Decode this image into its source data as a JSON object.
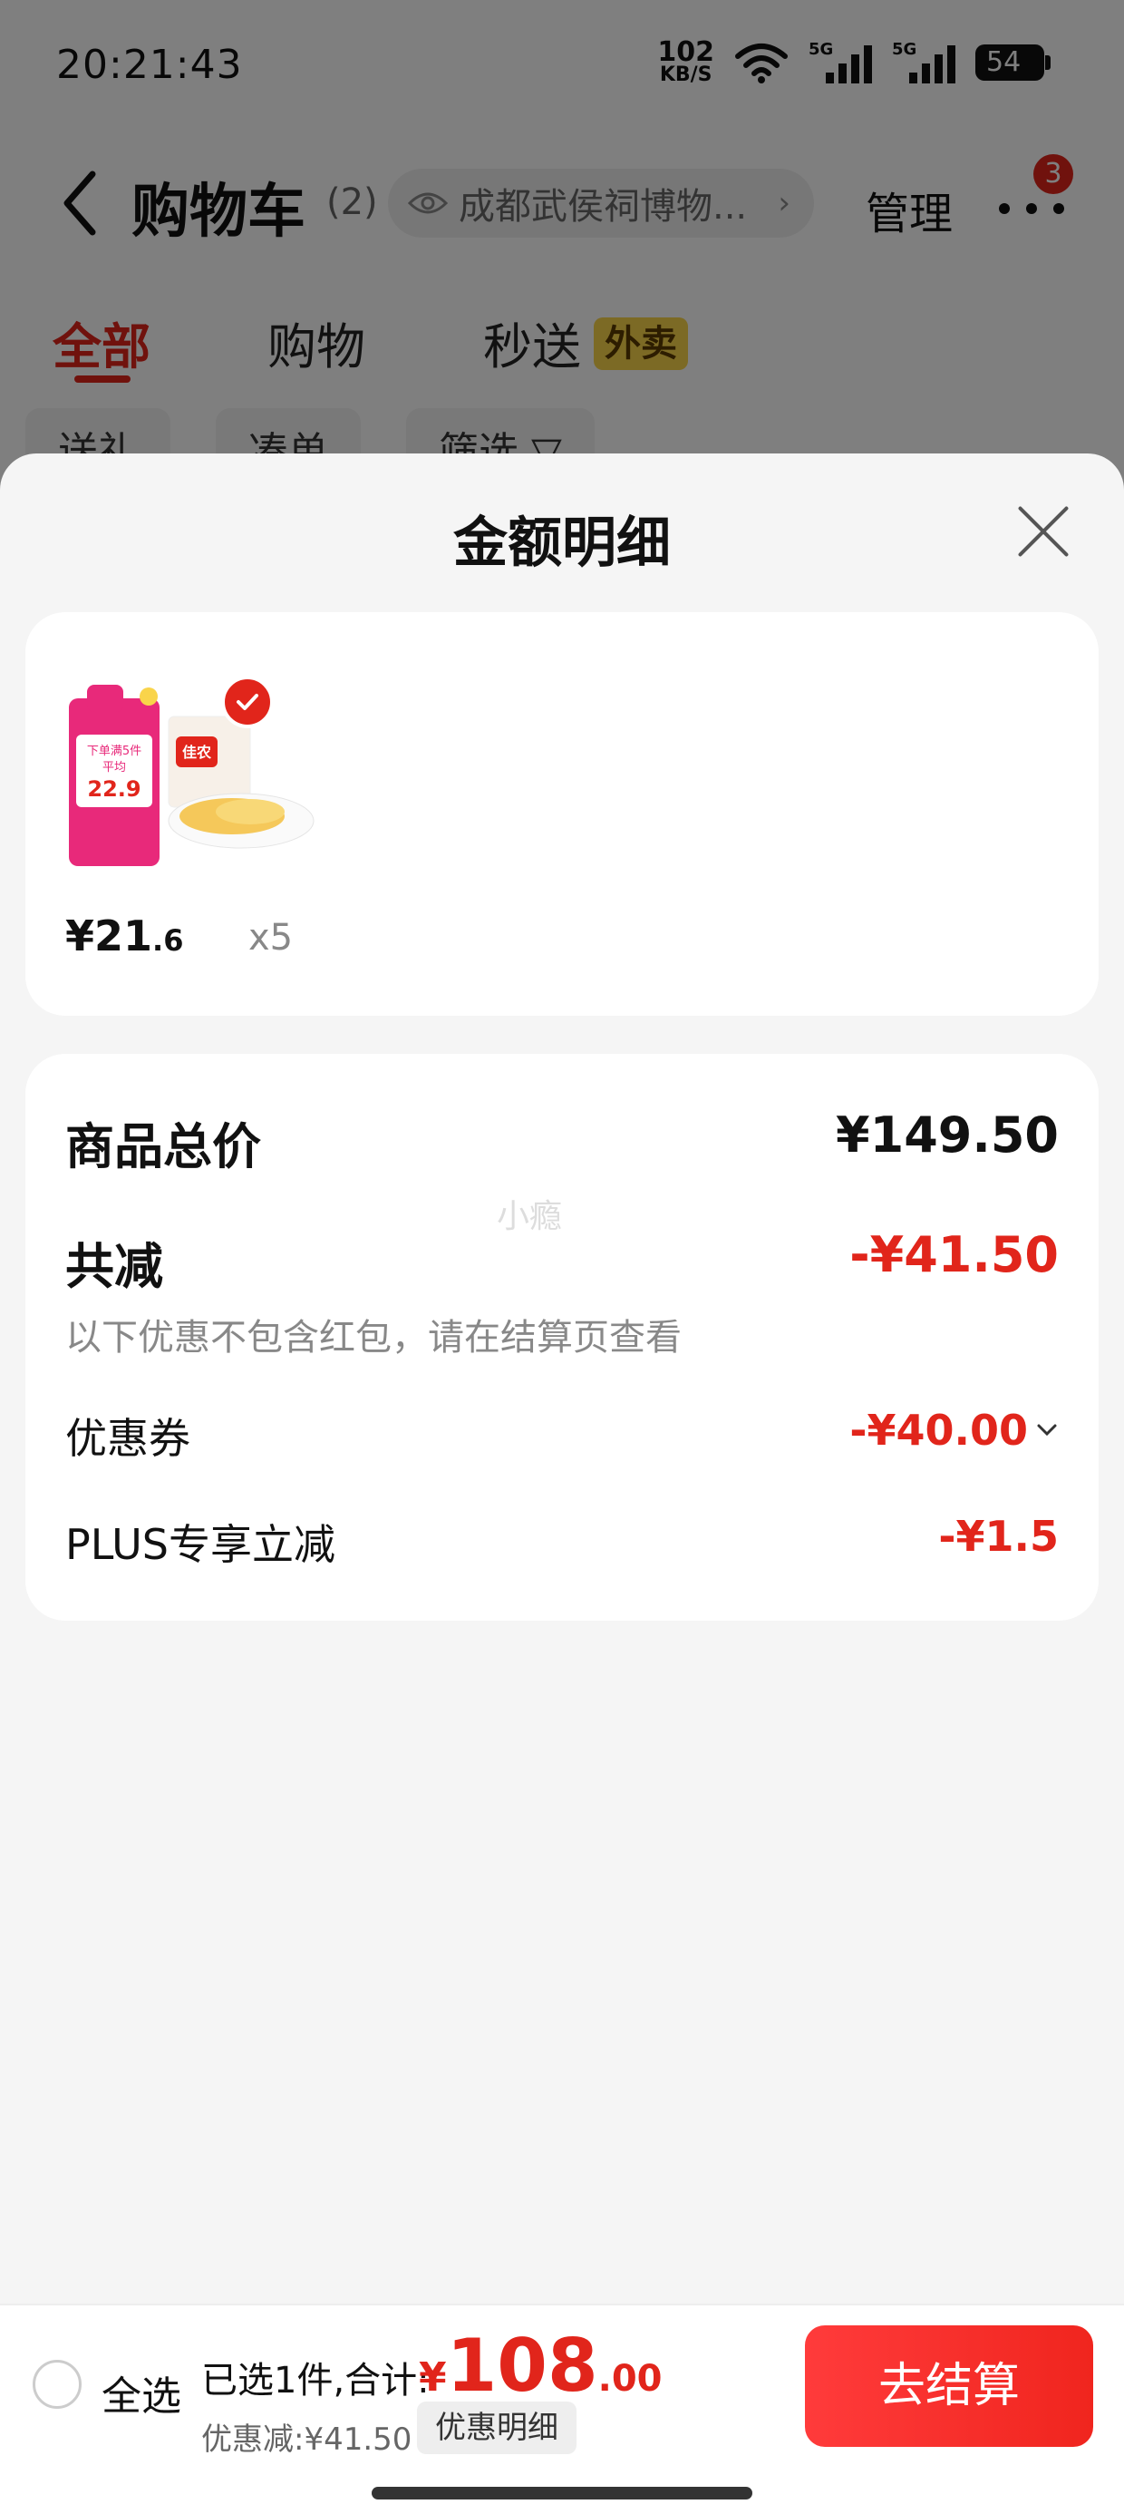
{
  "status_bar": {
    "time": "20:21:43",
    "net_speed_value": "102",
    "net_speed_unit": "KB/S",
    "signal1_label": "5G",
    "signal2_label": "5G",
    "battery": "54"
  },
  "nav": {
    "title": "购物车",
    "count": "(2)",
    "location": "成都武侯祠博物...",
    "manage": "管理",
    "badge": "3"
  },
  "tabs": [
    {
      "label": "全部",
      "active": true
    },
    {
      "label": "购物",
      "active": false
    },
    {
      "label": "秒送",
      "active": false
    }
  ],
  "tab_tag": "外卖",
  "filters": [
    "送礼",
    "凑单",
    "筛选 ▽"
  ],
  "sheet": {
    "title": "金额明细",
    "product": {
      "price_int": "¥21",
      "price_dec": ".6",
      "qty": "x5",
      "img_brand": "佳农",
      "img_promo": "下单满5件",
      "img_avg": "平均",
      "img_price": "22.9"
    },
    "watermark": "小瘾",
    "total_label": "商品总价",
    "total_value": "¥149.50",
    "reduce_label": "共减",
    "reduce_value": "-¥41.50",
    "note": "以下优惠不包含红包，请在结算页查看",
    "coupon_label": "优惠券",
    "coupon_value": "-¥40.00",
    "plus_label": "PLUS专享立减",
    "plus_value": "-¥1.5"
  },
  "bottom": {
    "select_all": "全选",
    "selected_text": "已选1件,合计:",
    "currency": "¥",
    "total_int": "108",
    "total_dec": ".00",
    "saving": "优惠减:¥41.50",
    "detail": "优惠明细",
    "checkout": "去结算"
  },
  "colors": {
    "accent": "#e1251b",
    "tag_yellow": "#f9d44a",
    "sheet_bg": "#f5f5f5"
  },
  "icons": [
    "back-icon",
    "eye-icon",
    "chevron-right-icon",
    "more-icon",
    "close-icon",
    "check-icon",
    "chevron-down-icon",
    "wifi-icon",
    "signal-icon",
    "battery-icon"
  ]
}
